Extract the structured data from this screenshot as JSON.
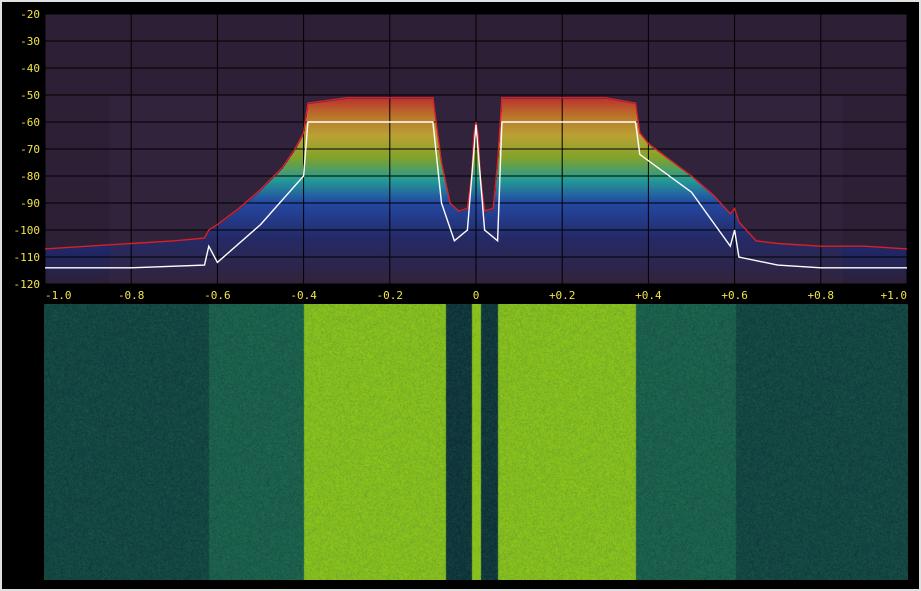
{
  "colors": {
    "background": "#000000",
    "plot_background": "#2d2036",
    "grid": "#000000",
    "tick_label": "#f2e44a",
    "waterfall_low": "#0b2233",
    "waterfall_mid": "#1e6a50",
    "waterfall_high": "#8fc41a"
  },
  "chart_data": [
    {
      "type": "area",
      "name_hint": "spectrum-plot",
      "xlim": [
        -1.0,
        1.0
      ],
      "ylim": [
        -120,
        -20
      ],
      "grid": true,
      "y_ticks": [
        "-20",
        "-30",
        "-40",
        "-50",
        "-60",
        "-70",
        "-80",
        "-90",
        "-100",
        "-110",
        "-120"
      ],
      "y_tick_values": [
        -20,
        -30,
        -40,
        -50,
        -60,
        -70,
        -80,
        -90,
        -100,
        -110,
        -120
      ],
      "x_ticks": [
        "-1.0",
        "-0.8",
        "-0.6",
        "-0.4",
        "-0.2",
        "0",
        "+0.2",
        "+0.4",
        "+0.6",
        "+0.8",
        "+1.0"
      ],
      "x_tick_values": [
        -1.0,
        -0.8,
        -0.6,
        -0.4,
        -0.2,
        0,
        0.2,
        0.4,
        0.6,
        0.8,
        1.0
      ],
      "series": [
        {
          "role": "peak",
          "color": "#d8202a",
          "x": [
            -1.0,
            -0.9,
            -0.8,
            -0.7,
            -0.63,
            -0.62,
            -0.6,
            -0.55,
            -0.5,
            -0.45,
            -0.42,
            -0.4,
            -0.39,
            -0.3,
            -0.2,
            -0.1,
            -0.08,
            -0.06,
            -0.04,
            -0.02,
            -0.01,
            -0.005,
            0,
            0.005,
            0.01,
            0.02,
            0.04,
            0.05,
            0.06,
            0.1,
            0.2,
            0.3,
            0.37,
            0.38,
            0.4,
            0.45,
            0.5,
            0.55,
            0.59,
            0.6,
            0.61,
            0.65,
            0.7,
            0.8,
            0.9,
            1.0
          ],
          "y": [
            -107,
            -106,
            -105,
            -104,
            -103,
            -100,
            -98,
            -92,
            -85,
            -77,
            -70,
            -64,
            -53,
            -51,
            -51,
            -51,
            -75,
            -90,
            -93,
            -92,
            -80,
            -65,
            -60,
            -65,
            -80,
            -93,
            -92,
            -75,
            -51,
            -51,
            -51,
            -51,
            -53,
            -64,
            -68,
            -74,
            -80,
            -87,
            -94,
            -92,
            -97,
            -104,
            -105,
            -106,
            -106,
            -107
          ]
        },
        {
          "role": "average",
          "color": "#ffffff",
          "x": [
            -1.0,
            -0.8,
            -0.63,
            -0.62,
            -0.6,
            -0.5,
            -0.4,
            -0.39,
            -0.2,
            -0.1,
            -0.08,
            -0.05,
            -0.02,
            0,
            0.02,
            0.05,
            0.06,
            0.2,
            0.37,
            0.38,
            0.5,
            0.59,
            0.6,
            0.61,
            0.7,
            0.8,
            1.0
          ],
          "y": [
            -114,
            -114,
            -113,
            -106,
            -112,
            -98,
            -80,
            -60,
            -60,
            -60,
            -90,
            -104,
            -100,
            -61,
            -100,
            -104,
            -60,
            -60,
            -60,
            -72,
            -86,
            -106,
            -100,
            -110,
            -113,
            -114,
            -114
          ]
        }
      ]
    },
    {
      "type": "heatmap",
      "name_hint": "waterfall",
      "xlim": [
        -1.0,
        1.0
      ],
      "levels": [
        {
          "x0": -1.0,
          "x1": -0.62,
          "level": 0.25
        },
        {
          "x0": -0.62,
          "x1": -0.4,
          "level": 0.42
        },
        {
          "x0": -0.4,
          "x1": -0.07,
          "level": 0.95
        },
        {
          "x0": -0.07,
          "x1": -0.01,
          "level": 0.15
        },
        {
          "x0": -0.01,
          "x1": 0.01,
          "level": 1.0
        },
        {
          "x0": 0.01,
          "x1": 0.05,
          "level": 0.15
        },
        {
          "x0": 0.05,
          "x1": 0.37,
          "level": 0.95
        },
        {
          "x0": 0.37,
          "x1": 0.6,
          "level": 0.42
        },
        {
          "x0": 0.6,
          "x1": 1.0,
          "level": 0.25
        }
      ]
    }
  ]
}
